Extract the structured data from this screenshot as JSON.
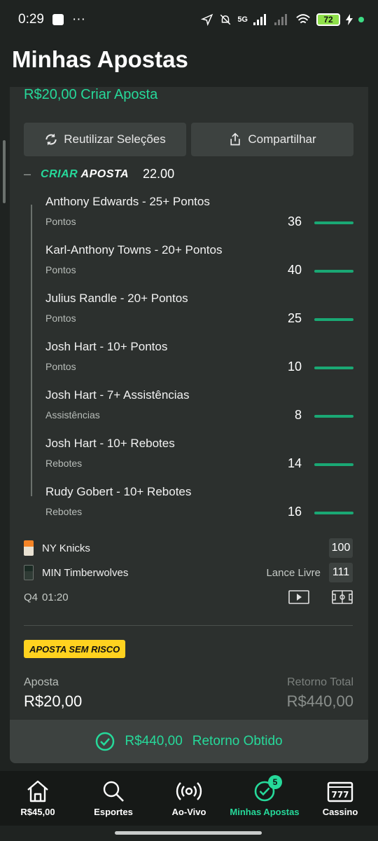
{
  "status_bar": {
    "time": "0:29",
    "dots": "···",
    "network": "5G",
    "battery": "72"
  },
  "page": {
    "title": "Minhas Apostas"
  },
  "bet_card": {
    "header_link": "R$20,00 Criar Aposta",
    "reuse_label": "Reutilizar Seleções",
    "share_label": "Compartilhar",
    "collapse_symbol": "–",
    "logo_part1": "CRIAR",
    "logo_part2": "APOSTA",
    "odds": "22.00",
    "legs": [
      {
        "title": "Anthony Edwards - 25+ Pontos",
        "market": "Pontos",
        "value": "36",
        "progress": 1.0
      },
      {
        "title": "Karl-Anthony Towns - 20+ Pontos",
        "market": "Pontos",
        "value": "40",
        "progress": 1.0
      },
      {
        "title": "Julius Randle - 20+ Pontos",
        "market": "Pontos",
        "value": "25",
        "progress": 1.0
      },
      {
        "title": "Josh Hart - 10+ Pontos",
        "market": "Pontos",
        "value": "10",
        "progress": 1.0
      },
      {
        "title": "Josh Hart - 7+ Assistências",
        "market": "Assistências",
        "value": "8",
        "progress": 1.0
      },
      {
        "title": "Josh Hart - 10+ Rebotes",
        "market": "Rebotes",
        "value": "14",
        "progress": 1.0
      },
      {
        "title": "Rudy Gobert - 10+ Rebotes",
        "market": "Rebotes",
        "value": "16",
        "progress": 1.0
      }
    ],
    "game": {
      "team1": {
        "name": "NY Knicks",
        "score": "100"
      },
      "team2": {
        "name": "MIN Timberwolves",
        "note": "Lance Livre",
        "score": "111"
      },
      "period": "Q4",
      "clock": "01:20"
    },
    "risk_badge": "APOSTA SEM RISCO",
    "stake_label": "Aposta",
    "stake_value": "R$20,00",
    "return_label": "Retorno Total",
    "return_value": "R$440,00",
    "result_amount": "R$440,00",
    "result_text": "Retorno Obtido"
  },
  "bottom_nav": [
    {
      "label": "R$45,00",
      "icon": "home-icon"
    },
    {
      "label": "Esportes",
      "icon": "search-icon"
    },
    {
      "label": "Ao-Vivo",
      "icon": "live-icon"
    },
    {
      "label": "Minhas Apostas",
      "icon": "check-circle-icon",
      "badge": "5",
      "active": true
    },
    {
      "label": "Cassino",
      "icon": "slot-machine-icon"
    }
  ],
  "colors": {
    "accent": "#26d99a",
    "badge_yellow": "#ffd21f",
    "bar_green": "#1aa874"
  }
}
